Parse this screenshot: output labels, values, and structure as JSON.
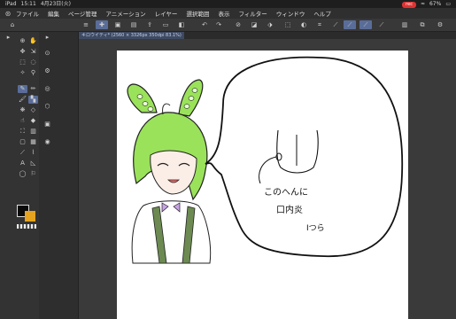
{
  "status": {
    "left_items": [
      "iPad",
      "15:11",
      "4月23日(火)"
    ],
    "right_items": [
      "rec",
      "WiFi",
      "67%"
    ]
  },
  "menu": {
    "app_icon": "clip-studio-logo-icon",
    "items": [
      "ファイル",
      "編集",
      "ページ管理",
      "アニメーション",
      "レイヤー",
      "選択範囲",
      "表示",
      "フィルター",
      "ウィンドウ",
      "ヘルプ"
    ]
  },
  "document": {
    "tab_label": "キロウイティ* (2560 × 3326px 350dpi 83.1%)"
  },
  "toolbar": {
    "colors": {
      "active": "#5a6d99",
      "panel": "#333333",
      "bar": "#383838"
    }
  },
  "canvas": {
    "text_lines": [
      "このへんに",
      "口内炎",
      "Iつら"
    ]
  }
}
